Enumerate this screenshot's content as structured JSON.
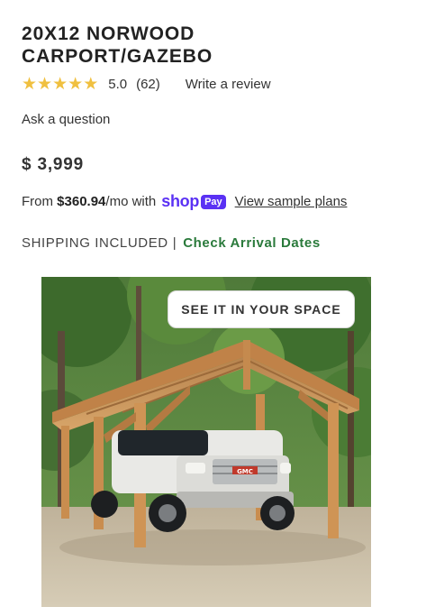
{
  "product": {
    "title_line1": "20X12 NORWOOD",
    "title_line2": "CARPORT/GAZEBO",
    "rating_value": "5.0",
    "rating_count": "(62)",
    "stars": 5,
    "write_review": "Write a review",
    "ask_question": "Ask a question",
    "price": "$ 3,999"
  },
  "financing": {
    "from_text": "From",
    "amount": "$360.94",
    "per_month": "/mo with",
    "shop_word": "shop",
    "pay_badge": "Pay",
    "sample_plans": "View sample plans"
  },
  "shipping": {
    "text": "SHIPPING INCLUDED",
    "separator": "|",
    "arrival_link": "Check Arrival Dates"
  },
  "image": {
    "cta": "SEE IT IN YOUR SPACE",
    "brand_badge": "GMC"
  },
  "colors": {
    "star": "#f0c040",
    "shop_purple": "#5a31f4",
    "arrival_green": "#2a7a3b"
  }
}
